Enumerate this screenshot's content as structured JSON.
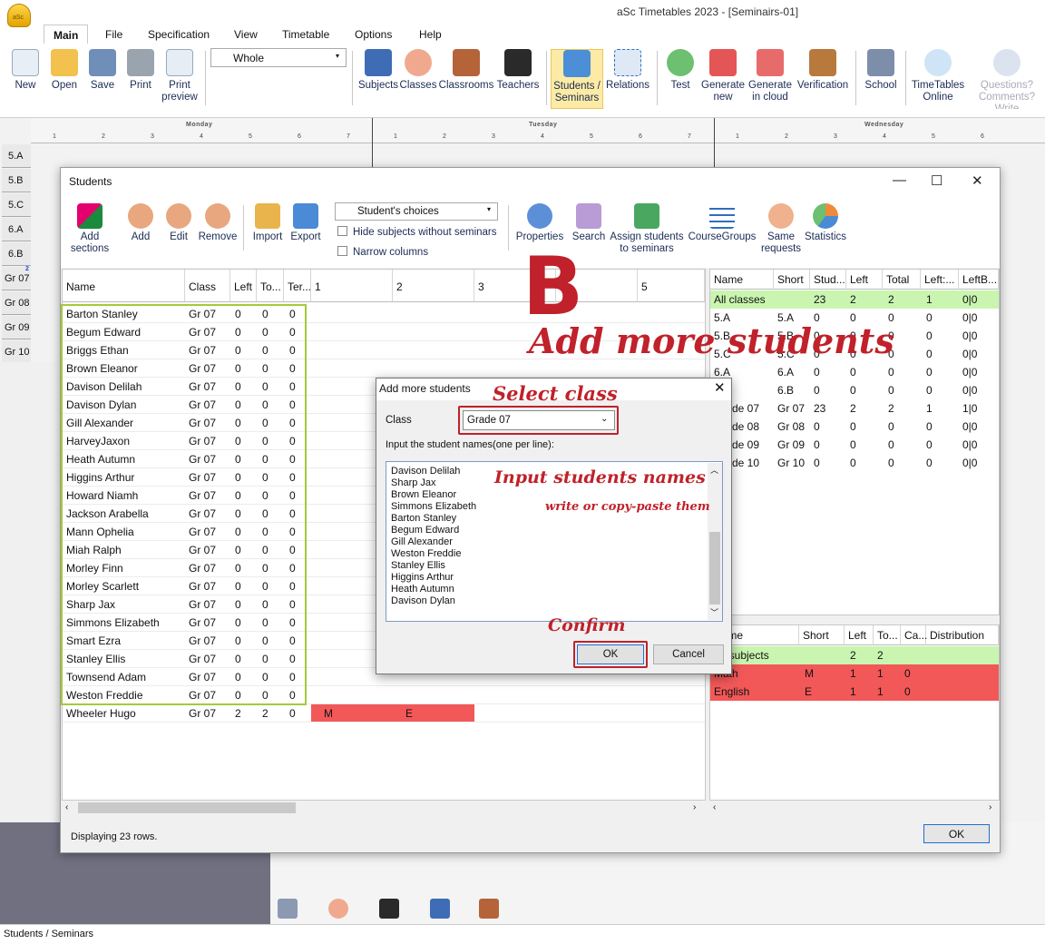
{
  "app": {
    "title": "aSc Timetables 2023  - [Seminairs-01]",
    "logo_text": "aSc"
  },
  "menu": [
    "Main",
    "File",
    "Specification",
    "View",
    "Timetable",
    "Options",
    "Help"
  ],
  "ribbon": {
    "new": "New",
    "open": "Open",
    "save": "Save",
    "print": "Print",
    "print_preview": "Print preview",
    "view_select": "Whole",
    "subjects": "Subjects",
    "classes": "Classes",
    "classrooms": "Classrooms",
    "teachers": "Teachers",
    "students_seminars": "Students / Seminars",
    "relations": "Relations",
    "test": "Test",
    "generate_new": "Generate new",
    "generate_cloud": "Generate in cloud",
    "verification": "Verification",
    "school": "School",
    "timetables_online": "TimeTables Online",
    "questions": "Questions? Comments? Write"
  },
  "timetable": {
    "days": [
      "Monday",
      "Tuesday",
      "Wednesday"
    ],
    "periods": [
      "1",
      "2",
      "3",
      "4",
      "5",
      "6",
      "7"
    ],
    "rows": [
      "5.A",
      "5.B",
      "5.C",
      "6.A",
      "6.B",
      "Gr 07",
      "Gr 08",
      "Gr 09",
      "Gr 10"
    ],
    "gr07_badge": "2"
  },
  "students_window": {
    "title": "Students",
    "toolbar": {
      "add_sections": "Add sections",
      "add": "Add",
      "edit": "Edit",
      "remove": "Remove",
      "import": "Import",
      "export": "Export",
      "choice_select": "Student's choices",
      "hide_subjects": "Hide subjects without seminars",
      "narrow_columns": "Narrow columns",
      "properties": "Properties",
      "search": "Search",
      "assign": "Assign students to seminars",
      "coursegroups": "CourseGroups",
      "same_requests": "Same requests",
      "statistics": "Statistics"
    },
    "columns": [
      "Name",
      "Class",
      "Left",
      "To...",
      "Ter...",
      "1",
      "2",
      "3",
      "4",
      "5"
    ],
    "students": [
      {
        "name": "Barton Stanley",
        "cls": "Gr 07",
        "left": "0",
        "to": "0",
        "ter": "0"
      },
      {
        "name": "Begum Edward",
        "cls": "Gr 07",
        "left": "0",
        "to": "0",
        "ter": "0"
      },
      {
        "name": "Briggs Ethan",
        "cls": "Gr 07",
        "left": "0",
        "to": "0",
        "ter": "0"
      },
      {
        "name": "Brown Eleanor",
        "cls": "Gr 07",
        "left": "0",
        "to": "0",
        "ter": "0"
      },
      {
        "name": "Davison Delilah",
        "cls": "Gr 07",
        "left": "0",
        "to": "0",
        "ter": "0"
      },
      {
        "name": "Davison Dylan",
        "cls": "Gr 07",
        "left": "0",
        "to": "0",
        "ter": "0"
      },
      {
        "name": "Gill Alexander",
        "cls": "Gr 07",
        "left": "0",
        "to": "0",
        "ter": "0"
      },
      {
        "name": "HarveyJaxon",
        "cls": "Gr 07",
        "left": "0",
        "to": "0",
        "ter": "0"
      },
      {
        "name": "Heath Autumn",
        "cls": "Gr 07",
        "left": "0",
        "to": "0",
        "ter": "0"
      },
      {
        "name": "Higgins Arthur",
        "cls": "Gr 07",
        "left": "0",
        "to": "0",
        "ter": "0"
      },
      {
        "name": "Howard Niamh",
        "cls": "Gr 07",
        "left": "0",
        "to": "0",
        "ter": "0"
      },
      {
        "name": "Jackson Arabella",
        "cls": "Gr 07",
        "left": "0",
        "to": "0",
        "ter": "0"
      },
      {
        "name": "Mann Ophelia",
        "cls": "Gr 07",
        "left": "0",
        "to": "0",
        "ter": "0"
      },
      {
        "name": "Miah Ralph",
        "cls": "Gr 07",
        "left": "0",
        "to": "0",
        "ter": "0"
      },
      {
        "name": "Morley Finn",
        "cls": "Gr 07",
        "left": "0",
        "to": "0",
        "ter": "0"
      },
      {
        "name": "Morley Scarlett",
        "cls": "Gr 07",
        "left": "0",
        "to": "0",
        "ter": "0"
      },
      {
        "name": "Sharp Jax",
        "cls": "Gr 07",
        "left": "0",
        "to": "0",
        "ter": "0"
      },
      {
        "name": "Simmons Elizabeth",
        "cls": "Gr 07",
        "left": "0",
        "to": "0",
        "ter": "0"
      },
      {
        "name": "Smart Ezra",
        "cls": "Gr 07",
        "left": "0",
        "to": "0",
        "ter": "0"
      },
      {
        "name": "Stanley Ellis",
        "cls": "Gr 07",
        "left": "0",
        "to": "0",
        "ter": "0"
      },
      {
        "name": "Townsend Adam",
        "cls": "Gr 07",
        "left": "0",
        "to": "0",
        "ter": "0"
      },
      {
        "name": "Weston Freddie",
        "cls": "Gr 07",
        "left": "0",
        "to": "0",
        "ter": "0"
      },
      {
        "name": "Wheeler  Hugo",
        "cls": "Gr 07",
        "left": "2",
        "to": "2",
        "ter": "0",
        "s1": "M",
        "s2": "E"
      }
    ],
    "status": "Displaying 23 rows.",
    "ok": "OK"
  },
  "classes_panel": {
    "columns": [
      "Name",
      "Short",
      "Stud...",
      "Left",
      "Total",
      "Left:...",
      "LeftB..."
    ],
    "rows": [
      {
        "name": "All classes",
        "short": "",
        "stud": "23",
        "left": "2",
        "total": "2",
        "leftc": "1",
        "leftb": "0|0"
      },
      {
        "name": "5.A",
        "short": "5.A",
        "stud": "0",
        "left": "0",
        "total": "0",
        "leftc": "0",
        "leftb": "0|0"
      },
      {
        "name": "5.B",
        "short": "5.B",
        "stud": "0",
        "left": "0",
        "total": "0",
        "leftc": "0",
        "leftb": "0|0"
      },
      {
        "name": "5.C",
        "short": "5.C",
        "stud": "0",
        "left": "0",
        "total": "0",
        "leftc": "0",
        "leftb": "0|0"
      },
      {
        "name": "6.A",
        "short": "6.A",
        "stud": "0",
        "left": "0",
        "total": "0",
        "leftc": "0",
        "leftb": "0|0"
      },
      {
        "name": "6.B",
        "short": "6.B",
        "stud": "0",
        "left": "0",
        "total": "0",
        "leftc": "0",
        "leftb": "0|0"
      },
      {
        "name": "Grade 07",
        "short": "Gr 07",
        "stud": "23",
        "left": "2",
        "total": "2",
        "leftc": "1",
        "leftb": "1|0"
      },
      {
        "name": "Grade 08",
        "short": "Gr 08",
        "stud": "0",
        "left": "0",
        "total": "0",
        "leftc": "0",
        "leftb": "0|0"
      },
      {
        "name": "Grade 09",
        "short": "Gr 09",
        "stud": "0",
        "left": "0",
        "total": "0",
        "leftc": "0",
        "leftb": "0|0"
      },
      {
        "name": "Grade 10",
        "short": "Gr 10",
        "stud": "0",
        "left": "0",
        "total": "0",
        "leftc": "0",
        "leftb": "0|0"
      }
    ]
  },
  "subjects_panel": {
    "columns": [
      "Name",
      "Short",
      "Left",
      "To...",
      "Ca...",
      "Distribution"
    ],
    "rows": [
      {
        "name": "All subjects",
        "short": "",
        "left": "2",
        "to": "2",
        "ca": ""
      },
      {
        "name": "Math",
        "short": "M",
        "left": "1",
        "to": "1",
        "ca": "0"
      },
      {
        "name": "English",
        "short": "E",
        "left": "1",
        "to": "1",
        "ca": "0"
      }
    ]
  },
  "dialog": {
    "title": "Add more students",
    "class_label": "Class",
    "class_value": "Grade 07",
    "input_label": "Input the student names(one per line):",
    "names": [
      "Davison Delilah",
      "Sharp Jax",
      "Brown Eleanor",
      "Simmons Elizabeth",
      "Barton Stanley",
      "Begum Edward",
      "Gill Alexander",
      "Weston Freddie",
      "Stanley Ellis",
      "Higgins Arthur",
      "Heath Autumn",
      "Davison Dylan"
    ],
    "ok": "OK",
    "cancel": "Cancel"
  },
  "annotations": {
    "letter": "B",
    "heading": "Add more students",
    "select_class": "Select class",
    "input_names": "Input students names",
    "input_hint": "write or copy-paste them",
    "confirm": "Confirm"
  },
  "status_bar": "Students / Seminars",
  "colors": {
    "accent_red": "#c0212a",
    "row_green": "#c9f5b0",
    "cell_red": "#f25858",
    "highlight_box": "#a6c93a"
  }
}
